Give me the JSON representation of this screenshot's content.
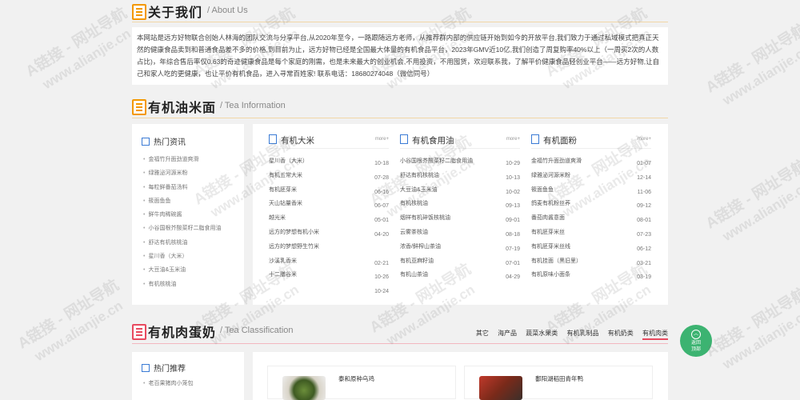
{
  "about": {
    "title": "关于我们",
    "subtitle": "/ About Us",
    "text": "本网站是远方好物联合创始人林海的团队交流与分享平台,从2020年至今，一路跟随远方老师，从推荐群内部的供应链开始到如今的开放平台,我们致力于通过私域模式把真正天然的健康食品卖到和普通食品差不多的价格,到目前为止，远方好物已经是全国最大体量的有机食品平台，2023年GMV近10亿,我们创造了周复购率40%以上（一周买2次的人数占比)，年综合售后率仅0.63的奇迹健康食品是每个家庭的刚需，也是未来最大的创业机会,不用投资，不用囤货，欢迎联系我，了解平价健康食品轻创业平台——远方好物,让自己和家人吃的更健康，也让平价有机食品，进入寻常百姓家! 联系电话：18680274048（微信同号）"
  },
  "oil_section": {
    "title": "有机油米面",
    "subtitle": "/ Tea Information",
    "hot": {
      "title": "热门资讯",
      "items": [
        "金福竹升面劲道爽滑",
        "绿雅泌河源米粉",
        "每粒鲜番茄汤料",
        "筱面鱼鱼",
        "鲜牛肉稀碗酱",
        "小谷国根芥酸菜籽二脂食用油",
        "舒达有机核桃油",
        "星川香（大米）",
        "大豆油&玉米油",
        "有机核桃油"
      ]
    },
    "columns": [
      {
        "title": "有机大米",
        "more": "more+",
        "items": [
          {
            "name": "星川香（大米）",
            "date": "10-18"
          },
          {
            "name": "有机五常大米",
            "date": "07-28"
          },
          {
            "name": "有机胚芽米",
            "date": "06-16"
          },
          {
            "name": "天山钻量香米",
            "date": "06-07"
          },
          {
            "name": "越光米",
            "date": "05-01"
          },
          {
            "name": "远方的梦想有机小米",
            "date": "04-20"
          },
          {
            "name": "远方的梦想野生竹米",
            "date": ""
          },
          {
            "name": "沙溪乳香米",
            "date": "02-21"
          },
          {
            "name": "十二膳谷米",
            "date": "10-26"
          },
          {
            "name": "",
            "date": "10-24"
          }
        ]
      },
      {
        "title": "有机食用油",
        "more": "more+",
        "items": [
          {
            "name": "小谷国根芥酸菜籽二脂食用油",
            "date": "10-29"
          },
          {
            "name": "舒达有机核桃油",
            "date": "10-13"
          },
          {
            "name": "大豆油&玉米油",
            "date": "10-02"
          },
          {
            "name": "有机核桃油",
            "date": "09-13"
          },
          {
            "name": "烟祥有机碎饭核桃油",
            "date": "09-01"
          },
          {
            "name": "云雾茶核油",
            "date": "08-18"
          },
          {
            "name": "浓香/鲜榨山茶油",
            "date": "07-19"
          },
          {
            "name": "有机亚麻籽油",
            "date": "07-01"
          },
          {
            "name": "有机山茶油",
            "date": "04-29"
          }
        ]
      },
      {
        "title": "有机面粉",
        "more": "more+",
        "items": [
          {
            "name": "金福竹升面劲道爽滑",
            "date": "01-07"
          },
          {
            "name": "绿雅泌河源米粉",
            "date": "12-14"
          },
          {
            "name": "筱面鱼鱼",
            "date": "11-06"
          },
          {
            "name": "鸽麦有机粉丝荞",
            "date": "09-12"
          },
          {
            "name": "番茄肉酱意面",
            "date": "08-01"
          },
          {
            "name": "有机胚芽米丝",
            "date": "07-23"
          },
          {
            "name": "有机胚芽米丝线",
            "date": "06-12"
          },
          {
            "name": "有机挂面（黑旧里）",
            "date": "03-21"
          },
          {
            "name": "有机原味小面条",
            "date": "03-19"
          }
        ]
      }
    ]
  },
  "meat_section": {
    "title": "有机肉蛋奶",
    "subtitle": "/ Tea Classification",
    "tabs": [
      "其它",
      "海产品",
      "蔬菜水果类",
      "有机乳制品",
      "有机奶类",
      "有机肉类"
    ],
    "hot": {
      "title": "热门推荐",
      "first_item": "老百果猪肉小笼包"
    },
    "cards": [
      {
        "title": "泰和原种乌鸡"
      },
      {
        "title": "鄱阳湖稻田青年鸭"
      }
    ]
  },
  "back_to_top": {
    "line1": "返回",
    "line2": "顶部"
  },
  "watermark": {
    "line1": "A链接 - 网址导航",
    "line2": "www.alianjie.cn"
  },
  "colors": {
    "accent": "#f39800",
    "meat_accent": "#e84a5f",
    "top_button": "#3cb371",
    "icon_blue": "#3a7bd5"
  }
}
